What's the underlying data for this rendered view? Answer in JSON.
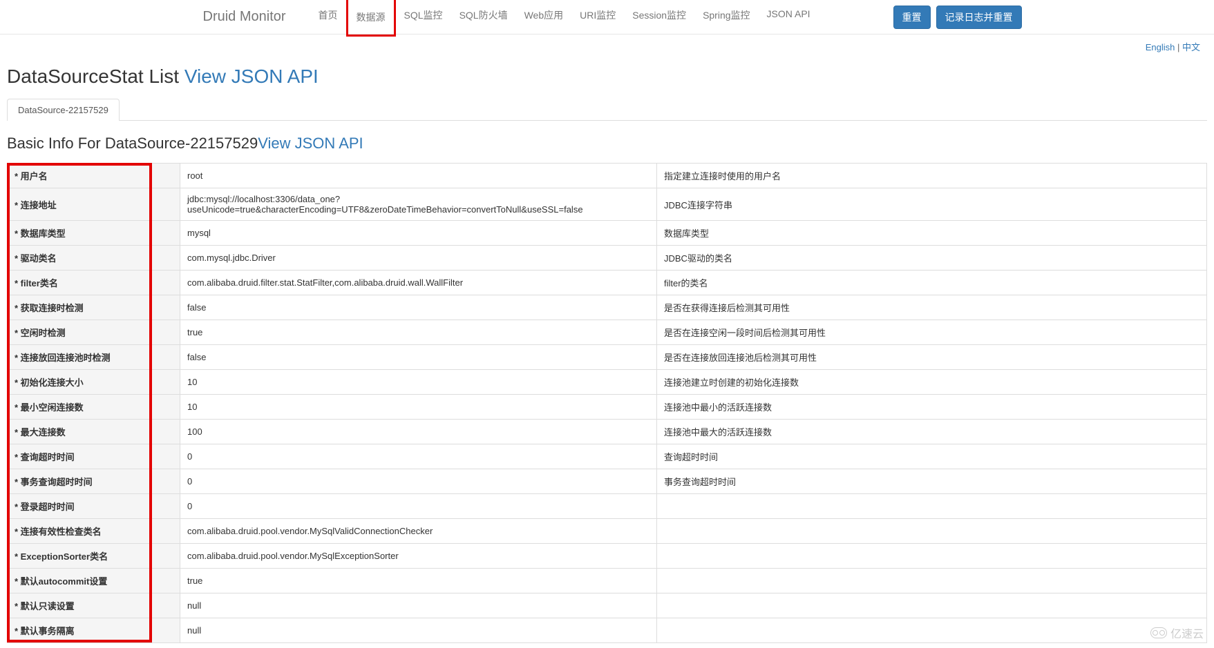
{
  "navbar": {
    "brand": "Druid Monitor",
    "links": [
      {
        "label": "首页"
      },
      {
        "label": "数据源",
        "highlighted": true
      },
      {
        "label": "SQL监控"
      },
      {
        "label": "SQL防火墙"
      },
      {
        "label": "Web应用"
      },
      {
        "label": "URI监控"
      },
      {
        "label": "Session监控"
      },
      {
        "label": "Spring监控"
      },
      {
        "label": "JSON API"
      }
    ],
    "btn_reset": "重置",
    "btn_log_reset": "记录日志并重置"
  },
  "lang": {
    "english": "English",
    "sep": " | ",
    "chinese": "中文"
  },
  "h1": {
    "title": "DataSourceStat List ",
    "link": "View JSON API"
  },
  "tab": {
    "label": "DataSource-22157529"
  },
  "h2": {
    "title": "Basic Info For DataSource-22157529",
    "link": "View JSON API"
  },
  "rows": [
    {
      "label": "* 用户名",
      "value": "root",
      "desc": "指定建立连接时使用的用户名"
    },
    {
      "label": "* 连接地址",
      "value": "jdbc:mysql://localhost:3306/data_one?useUnicode=true&characterEncoding=UTF8&zeroDateTimeBehavior=convertToNull&useSSL=false",
      "desc": "JDBC连接字符串"
    },
    {
      "label": "* 数据库类型",
      "value": "mysql",
      "desc": "数据库类型"
    },
    {
      "label": "* 驱动类名",
      "value": "com.mysql.jdbc.Driver",
      "desc": "JDBC驱动的类名"
    },
    {
      "label": "* filter类名",
      "value": "com.alibaba.druid.filter.stat.StatFilter,com.alibaba.druid.wall.WallFilter",
      "desc": "filter的类名"
    },
    {
      "label": "* 获取连接时检测",
      "value": "false",
      "desc": "是否在获得连接后检测其可用性"
    },
    {
      "label": "* 空闲时检测",
      "value": "true",
      "desc": "是否在连接空闲一段时间后检测其可用性"
    },
    {
      "label": "* 连接放回连接池时检测",
      "value": "false",
      "desc": "是否在连接放回连接池后检测其可用性"
    },
    {
      "label": "* 初始化连接大小",
      "value": "10",
      "desc": "连接池建立时创建的初始化连接数"
    },
    {
      "label": "* 最小空闲连接数",
      "value": "10",
      "desc": "连接池中最小的活跃连接数"
    },
    {
      "label": "* 最大连接数",
      "value": "100",
      "desc": "连接池中最大的活跃连接数"
    },
    {
      "label": "* 查询超时时间",
      "value": "0",
      "desc": "查询超时时间"
    },
    {
      "label": "* 事务查询超时时间",
      "value": "0",
      "desc": "事务查询超时时间"
    },
    {
      "label": "* 登录超时时间",
      "value": "0",
      "desc": ""
    },
    {
      "label": "* 连接有效性检查类名",
      "value": "com.alibaba.druid.pool.vendor.MySqlValidConnectionChecker",
      "desc": ""
    },
    {
      "label": "* ExceptionSorter类名",
      "value": "com.alibaba.druid.pool.vendor.MySqlExceptionSorter",
      "desc": ""
    },
    {
      "label": "* 默认autocommit设置",
      "value": "true",
      "desc": ""
    },
    {
      "label": "* 默认只读设置",
      "value": "null",
      "desc": ""
    },
    {
      "label": "* 默认事务隔离",
      "value": "null",
      "desc": ""
    }
  ],
  "watermark": "亿速云"
}
